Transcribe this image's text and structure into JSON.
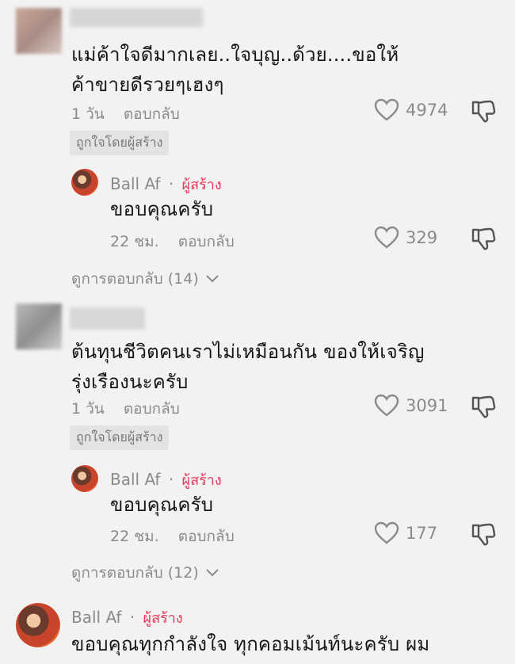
{
  "comments": [
    {
      "text_line1": "แม่ค้าใจดีมากเลย..ใจบุญ..ด้วย....ขอให้",
      "text_line2": "ค้าขายดีรวยๆเฮงๆ",
      "time": "1 วัน",
      "reply_label": "ตอบกลับ",
      "likes": "4974",
      "badge": "ถูกใจโดยผู้สร้าง",
      "reply": {
        "name": "Ball Af",
        "dot": "·",
        "creator_label": "ผู้สร้าง",
        "text": "ขอบคุณครับ",
        "time": "22 ชม.",
        "reply_label": "ตอบกลับ",
        "likes": "329"
      },
      "view_replies": "ดูการตอบกลับ (14)"
    },
    {
      "text_line1": "ต้นทุนชีวิตคนเราไม่เหมือนกัน ของให้เจริญ",
      "text_line2": "รุ่งเรืองนะครับ",
      "time": "1 วัน",
      "reply_label": "ตอบกลับ",
      "likes": "3091",
      "badge": "ถูกใจโดยผู้สร้าง",
      "reply": {
        "name": "Ball Af",
        "dot": "·",
        "creator_label": "ผู้สร้าง",
        "text": "ขอบคุณครับ",
        "time": "22 ชม.",
        "reply_label": "ตอบกลับ",
        "likes": "177"
      },
      "view_replies": "ดูการตอบกลับ (12)"
    },
    {
      "name": "Ball Af",
      "dot": "·",
      "creator_label": "ผู้สร้าง",
      "text": "ขอบคุณทุกกำลังใจ ทุกคอมเม้นท์นะครับ ผม"
    }
  ],
  "colors": {
    "creator": "#e8385b",
    "meta": "#8a8a8a",
    "background": "#f2f2f2"
  },
  "icons": {
    "like": "heart-outline-icon",
    "dislike": "thumbs-down-icon",
    "expand": "chevron-down-icon"
  }
}
